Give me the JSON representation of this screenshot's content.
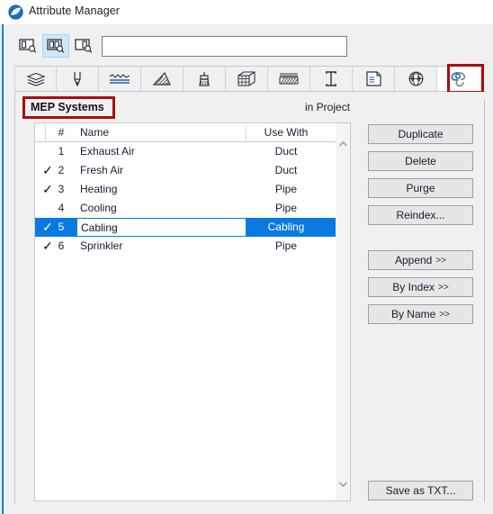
{
  "window": {
    "title": "Attribute Manager",
    "app_icon": "archicad-globe-icon"
  },
  "toolbar": {
    "view_modes": [
      {
        "name": "left-pane-view-icon",
        "label": "Show left pane only",
        "selected": false
      },
      {
        "name": "both-panes-view-icon",
        "label": "Show both panes",
        "selected": true
      },
      {
        "name": "right-pane-view-icon",
        "label": "Show right pane only",
        "selected": false
      }
    ],
    "search": {
      "value": "",
      "placeholder": ""
    }
  },
  "tabs": [
    {
      "name": "tab-building-materials",
      "icon": "layers-icon",
      "active": false
    },
    {
      "name": "tab-pen-sets",
      "icon": "pen-icon",
      "active": false
    },
    {
      "name": "tab-line-types",
      "icon": "line-types-icon",
      "active": false
    },
    {
      "name": "tab-fill-types",
      "icon": "fill-hatch-icon",
      "active": false
    },
    {
      "name": "tab-surfaces",
      "icon": "paint-brush-icon",
      "active": false
    },
    {
      "name": "tab-composites",
      "icon": "composite-wall-icon",
      "active": false
    },
    {
      "name": "tab-zone-categories",
      "icon": "zone-hatch-icon",
      "active": false
    },
    {
      "name": "tab-profiles",
      "icon": "i-beam-profile-icon",
      "active": false
    },
    {
      "name": "tab-layer-combinations",
      "icon": "layer-sheet-icon",
      "active": false
    },
    {
      "name": "tab-markup-styles",
      "icon": "globe-icon",
      "active": false
    },
    {
      "name": "tab-mep-systems",
      "icon": "mep-systems-icon",
      "active": true
    }
  ],
  "panel": {
    "attribute_type": "MEP Systems",
    "source_label": "in Project"
  },
  "list": {
    "columns": [
      "#",
      "Name",
      "Use With"
    ],
    "rows": [
      {
        "checked": false,
        "index": "1",
        "name": "Exhaust Air",
        "use_with": "Duct",
        "selected": false,
        "editing": false
      },
      {
        "checked": true,
        "index": "2",
        "name": "Fresh Air",
        "use_with": "Duct",
        "selected": false,
        "editing": false
      },
      {
        "checked": true,
        "index": "3",
        "name": "Heating",
        "use_with": "Pipe",
        "selected": false,
        "editing": false
      },
      {
        "checked": false,
        "index": "4",
        "name": "Cooling",
        "use_with": "Pipe",
        "selected": false,
        "editing": false
      },
      {
        "checked": true,
        "index": "5",
        "name": "Cabling",
        "use_with": "Cabling",
        "selected": true,
        "editing": true
      },
      {
        "checked": true,
        "index": "6",
        "name": "Sprinkler",
        "use_with": "Pipe",
        "selected": false,
        "editing": false
      }
    ],
    "check_glyph": "✓"
  },
  "scrollbar": {
    "up_glyph": "▲",
    "down_glyph": "▼"
  },
  "buttons": {
    "duplicate": "Duplicate",
    "delete": "Delete",
    "purge": "Purge",
    "reindex": "Reindex...",
    "append": "Append",
    "by_index": "By Index",
    "by_name": "By Name",
    "arrows": ">>",
    "save_as_txt": "Save as TXT..."
  },
  "annotations": {
    "highlight_color": "#a80e0e",
    "selection_color": "#0b7ae0",
    "accent_color": "#0c7fd8"
  }
}
